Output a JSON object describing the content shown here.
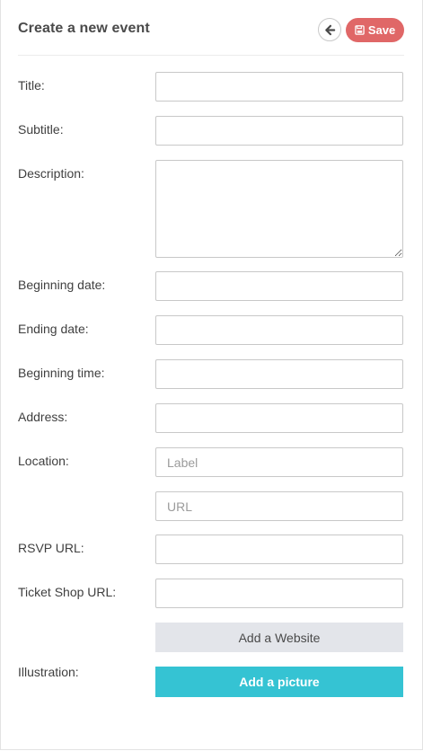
{
  "header": {
    "title": "Create a new event",
    "back_icon": "arrow-left-icon",
    "save_icon": "floppy-disk-icon",
    "save_label": "Save",
    "save_color": "#e06767"
  },
  "form": {
    "title_label": "Title:",
    "subtitle_label": "Subtitle:",
    "description_label": "Description:",
    "beginning_date_label": "Beginning date:",
    "ending_date_label": "Ending date:",
    "beginning_time_label": "Beginning time:",
    "address_label": "Address:",
    "location_label": "Location:",
    "location_label_placeholder": "Label",
    "location_url_placeholder": "URL",
    "rsvp_url_label": "RSVP URL:",
    "ticket_shop_url_label": "Ticket Shop URL:",
    "add_website_label": "Add a Website",
    "illustration_label": "Illustration:",
    "add_picture_label": "Add a picture",
    "add_picture_color": "#35c3d3"
  }
}
